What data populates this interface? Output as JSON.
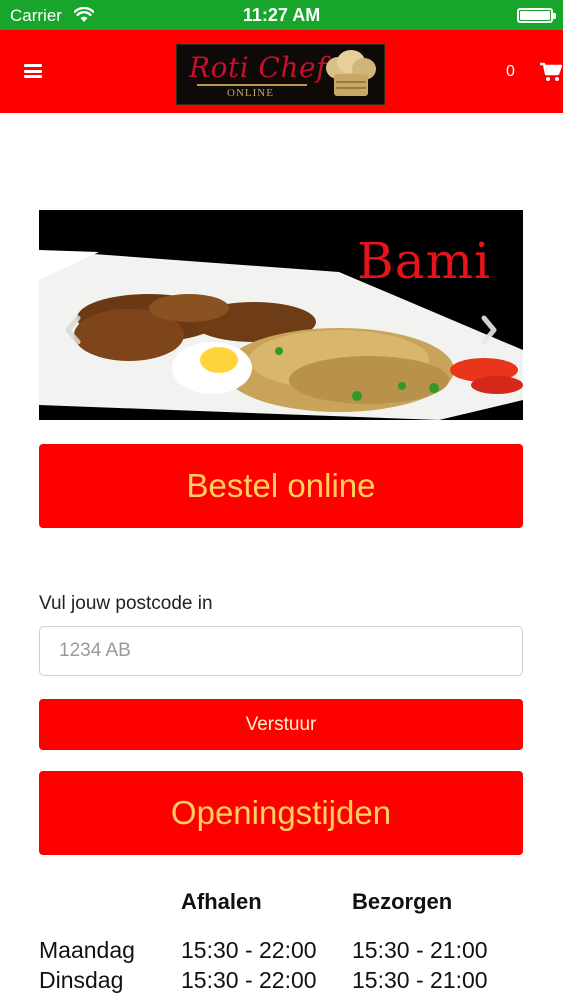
{
  "status_bar": {
    "carrier": "Carrier",
    "time": "11:27 AM"
  },
  "header": {
    "logo_title": "Roti Chef",
    "logo_subtitle": "ONLINE",
    "cart_count": "0"
  },
  "carousel": {
    "slide_caption": "Bami"
  },
  "order_button_label": "Bestel online",
  "postcode": {
    "label": "Vul jouw postcode in",
    "placeholder": "1234 AB",
    "value": "",
    "submit_label": "Verstuur"
  },
  "hours_button_label": "Openingstijden",
  "hours_table": {
    "columns": [
      "",
      "Afhalen",
      "Bezorgen"
    ],
    "rows": [
      {
        "day": "Maandag",
        "pickup": "15:30 - 22:00",
        "delivery": "15:30 - 21:00"
      },
      {
        "day": "Dinsdag",
        "pickup": "15:30 - 22:00",
        "delivery": "15:30 - 21:00"
      }
    ]
  },
  "colors": {
    "status_bar": "#17a52b",
    "brand_red": "#ff0000",
    "button_text_gold": "#ffd060"
  }
}
